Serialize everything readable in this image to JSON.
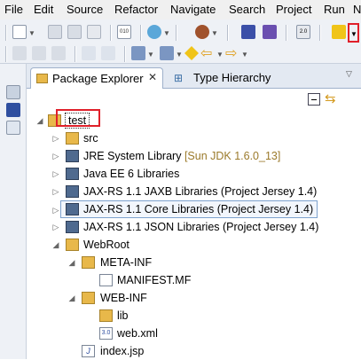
{
  "menu": [
    "File",
    "Edit",
    "Source",
    "Refactor",
    "Navigate",
    "Search",
    "Project",
    "Run",
    "N"
  ],
  "tabs": {
    "package_explorer": "Package Explorer",
    "type_hierarchy": "Type Hierarchy"
  },
  "tree": {
    "project": "test",
    "src": "src",
    "jre_label": "JRE System Library",
    "jre_decoration": "[Sun JDK 1.6.0_13]",
    "javaee": "Java EE 6 Libraries",
    "jaxb": "JAX-RS 1.1 JAXB Libraries (Project Jersey 1.4)",
    "core": "JAX-RS 1.1 Core Libraries (Project Jersey 1.4)",
    "json": "JAX-RS 1.1 JSON Libraries (Project Jersey 1.4)",
    "webroot": "WebRoot",
    "metainf": "META-INF",
    "manifest": "MANIFEST.MF",
    "webinf": "WEB-INF",
    "lib": "lib",
    "webxml": "web.xml",
    "indexjsp": "index.jsp"
  },
  "colors": {
    "highlight_box": "#e0202a",
    "selection_border": "#7da2ce",
    "folder": "#e8b84a",
    "library": "#4f6a8f",
    "decoration": "#9b7a2b"
  }
}
